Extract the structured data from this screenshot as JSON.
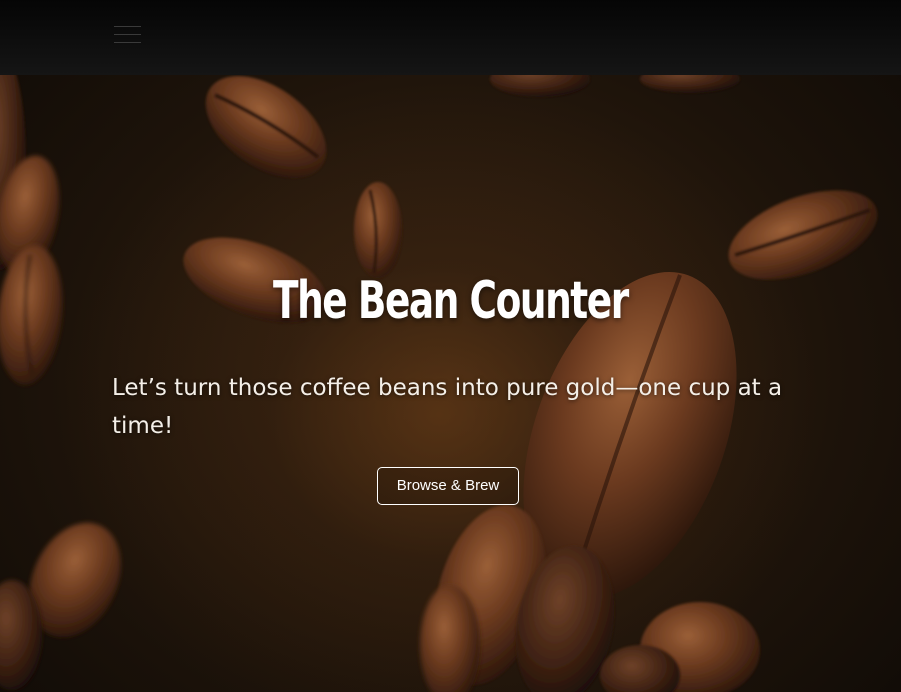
{
  "navbar": {
    "menu_icon": "hamburger-menu-icon"
  },
  "hero": {
    "title": "The Bean Counter",
    "subtitle": "Let’s turn those coffee beans into pure gold—one cup at a time!",
    "cta_label": "Browse & Brew",
    "background_image": "coffee-beans-photo"
  },
  "colors": {
    "navbar_bg": "#0f0f0f",
    "hero_bg": "#1d130a",
    "bean": "#5a3219",
    "text": "#ffffff"
  }
}
